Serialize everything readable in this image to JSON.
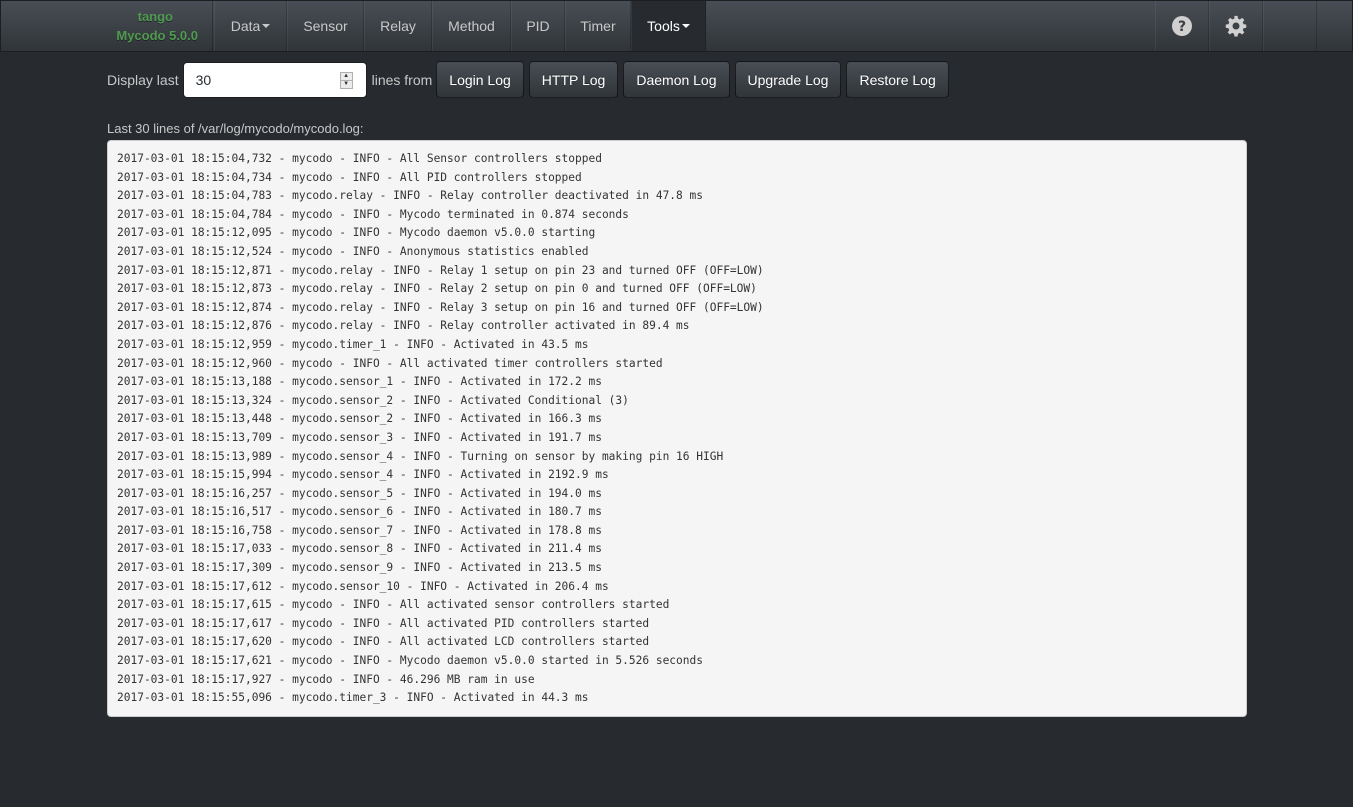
{
  "brand": {
    "line1": "tango",
    "line2": "Mycodo 5.0.0",
    "color": "#4f9a4f"
  },
  "nav": {
    "items": [
      {
        "label": "Data",
        "dropdown": true,
        "active": false
      },
      {
        "label": "Sensor",
        "dropdown": false,
        "active": false
      },
      {
        "label": "Relay",
        "dropdown": false,
        "active": false
      },
      {
        "label": "Method",
        "dropdown": false,
        "active": false
      },
      {
        "label": "PID",
        "dropdown": false,
        "active": false
      },
      {
        "label": "Timer",
        "dropdown": false,
        "active": false
      },
      {
        "label": "Tools",
        "dropdown": true,
        "active": true
      }
    ],
    "right_icons": [
      {
        "icon": "help-icon",
        "glyph": "?"
      },
      {
        "icon": "gear-icon",
        "glyph": "⚙"
      }
    ]
  },
  "toolbar": {
    "display_last_label": "Display last",
    "lines_value": "30",
    "lines_from_label": "lines from",
    "buttons": [
      {
        "label": "Login Log"
      },
      {
        "label": "HTTP Log"
      },
      {
        "label": "Daemon Log"
      },
      {
        "label": "Upgrade Log"
      },
      {
        "label": "Restore Log"
      }
    ]
  },
  "log": {
    "caption": "Last 30 lines of /var/log/mycodo/mycodo.log:",
    "lines": [
      "2017-03-01 18:15:04,732 - mycodo - INFO - All Sensor controllers stopped",
      "2017-03-01 18:15:04,734 - mycodo - INFO - All PID controllers stopped",
      "2017-03-01 18:15:04,783 - mycodo.relay - INFO - Relay controller deactivated in 47.8 ms",
      "2017-03-01 18:15:04,784 - mycodo - INFO - Mycodo terminated in 0.874 seconds",
      "2017-03-01 18:15:12,095 - mycodo - INFO - Mycodo daemon v5.0.0 starting",
      "2017-03-01 18:15:12,524 - mycodo - INFO - Anonymous statistics enabled",
      "2017-03-01 18:15:12,871 - mycodo.relay - INFO - Relay 1 setup on pin 23 and turned OFF (OFF=LOW)",
      "2017-03-01 18:15:12,873 - mycodo.relay - INFO - Relay 2 setup on pin 0 and turned OFF (OFF=LOW)",
      "2017-03-01 18:15:12,874 - mycodo.relay - INFO - Relay 3 setup on pin 16 and turned OFF (OFF=LOW)",
      "2017-03-01 18:15:12,876 - mycodo.relay - INFO - Relay controller activated in 89.4 ms",
      "2017-03-01 18:15:12,959 - mycodo.timer_1 - INFO - Activated in 43.5 ms",
      "2017-03-01 18:15:12,960 - mycodo - INFO - All activated timer controllers started",
      "2017-03-01 18:15:13,188 - mycodo.sensor_1 - INFO - Activated in 172.2 ms",
      "2017-03-01 18:15:13,324 - mycodo.sensor_2 - INFO - Activated Conditional (3)",
      "2017-03-01 18:15:13,448 - mycodo.sensor_2 - INFO - Activated in 166.3 ms",
      "2017-03-01 18:15:13,709 - mycodo.sensor_3 - INFO - Activated in 191.7 ms",
      "2017-03-01 18:15:13,989 - mycodo.sensor_4 - INFO - Turning on sensor by making pin 16 HIGH",
      "2017-03-01 18:15:15,994 - mycodo.sensor_4 - INFO - Activated in 2192.9 ms",
      "2017-03-01 18:15:16,257 - mycodo.sensor_5 - INFO - Activated in 194.0 ms",
      "2017-03-01 18:15:16,517 - mycodo.sensor_6 - INFO - Activated in 180.7 ms",
      "2017-03-01 18:15:16,758 - mycodo.sensor_7 - INFO - Activated in 178.8 ms",
      "2017-03-01 18:15:17,033 - mycodo.sensor_8 - INFO - Activated in 211.4 ms",
      "2017-03-01 18:15:17,309 - mycodo.sensor_9 - INFO - Activated in 213.5 ms",
      "2017-03-01 18:15:17,612 - mycodo.sensor_10 - INFO - Activated in 206.4 ms",
      "2017-03-01 18:15:17,615 - mycodo - INFO - All activated sensor controllers started",
      "2017-03-01 18:15:17,617 - mycodo - INFO - All activated PID controllers started",
      "2017-03-01 18:15:17,620 - mycodo - INFO - All activated LCD controllers started",
      "2017-03-01 18:15:17,621 - mycodo - INFO - Mycodo daemon v5.0.0 started in 5.526 seconds",
      "2017-03-01 18:15:17,927 - mycodo - INFO - 46.296 MB ram in use",
      "2017-03-01 18:15:55,096 - mycodo.timer_3 - INFO - Activated in 44.3 ms"
    ]
  }
}
